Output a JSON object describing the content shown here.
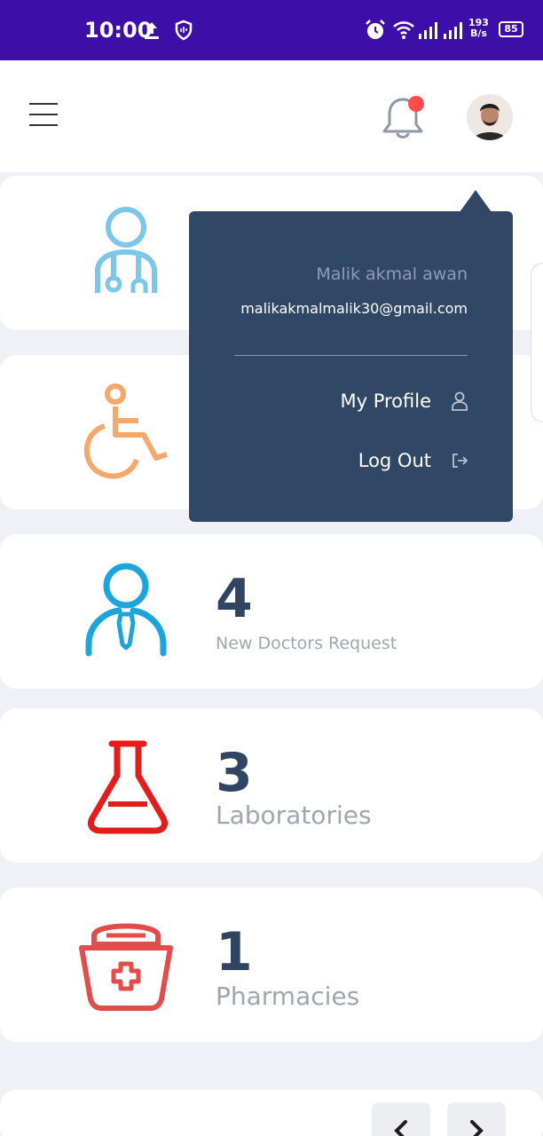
{
  "status_bar": {
    "time": "10:00",
    "net_speed_value": "193",
    "net_speed_unit": "B/s",
    "battery": "85"
  },
  "header": {
    "menu_icon": "hamburger-icon",
    "notification_icon": "bell-icon",
    "avatar_alt": "profile-avatar"
  },
  "dashboard": {
    "cards": [
      {
        "icon": "doctor-icon",
        "count": "",
        "label": "",
        "color": "#7cc6ea"
      },
      {
        "icon": "wheelchair-icon",
        "count": "",
        "label": "",
        "color": "#f6a86a"
      },
      {
        "icon": "doctor-request-icon",
        "count": "4",
        "label": "New Doctors Request",
        "color": "#1aa6dc"
      },
      {
        "icon": "lab-flask-icon",
        "count": "3",
        "label": "Laboratories",
        "color": "#e41c1c"
      },
      {
        "icon": "pharmacy-kit-icon",
        "count": "1",
        "label": "Pharmacies",
        "color": "#e24c4c"
      }
    ]
  },
  "dropdown": {
    "user_name": "Malik akmal awan",
    "email": "malikakmalmalik30@gmail.com",
    "items": [
      {
        "label": "My Profile",
        "icon": "user-icon"
      },
      {
        "label": "Log Out",
        "icon": "logout-icon"
      }
    ]
  },
  "pager": {
    "prev_icon": "chevron-left-icon",
    "next_icon": "chevron-right-icon"
  },
  "colors": {
    "status_bar": "#3d0fa8",
    "dropdown_bg": "#304866",
    "count_text": "#2f4562",
    "label_text": "#a0a6b1",
    "notification_dot": "#ff4d4d"
  }
}
